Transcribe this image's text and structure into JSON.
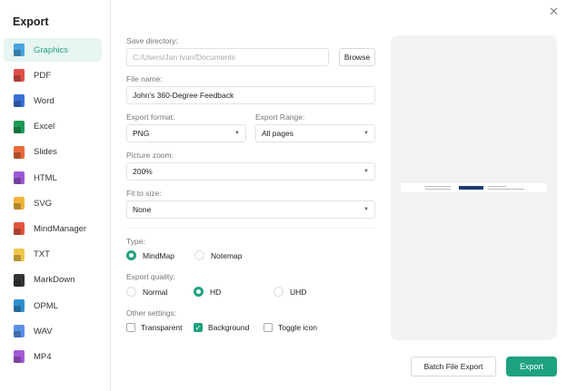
{
  "title": "Export",
  "sidebar": {
    "items": [
      {
        "label": "Graphics",
        "color": "#4aa3e0"
      },
      {
        "label": "PDF",
        "color": "#e0504a"
      },
      {
        "label": "Word",
        "color": "#3b6fd8"
      },
      {
        "label": "Excel",
        "color": "#1f9a55"
      },
      {
        "label": "Slides",
        "color": "#e86a3a"
      },
      {
        "label": "HTML",
        "color": "#9b59d6"
      },
      {
        "label": "SVG",
        "color": "#f0b43c"
      },
      {
        "label": "MindManager",
        "color": "#e2553f"
      },
      {
        "label": "TXT",
        "color": "#f0c64a"
      },
      {
        "label": "MarkDown",
        "color": "#333333"
      },
      {
        "label": "OPML",
        "color": "#2e8fd0"
      },
      {
        "label": "WAV",
        "color": "#5b8fe6"
      },
      {
        "label": "MP4",
        "color": "#a45ad6"
      }
    ]
  },
  "form": {
    "save_directory_label": "Save directory:",
    "save_directory_placeholder": "C:/Users/Jan Ivan/Documents",
    "browse": "Browse",
    "file_name_label": "File name:",
    "file_name": "John's 360-Degree Feedback",
    "export_format_label": "Export format:",
    "export_format": "PNG",
    "export_range_label": "Export Range:",
    "export_range": "All pages",
    "picture_zoom_label": "Picture zoom:",
    "picture_zoom": "200%",
    "fit_label": "Fit to size:",
    "fit": "None",
    "type_label": "Type:",
    "type_options": [
      "MindMap",
      "Notemap"
    ],
    "quality_label": "Export quality:",
    "quality_options": [
      "Normal",
      "HD",
      "UHD"
    ],
    "other_label": "Other settings:",
    "other_options": [
      "Transparent",
      "Background",
      "Toggle icon"
    ]
  },
  "buttons": {
    "batch": "Batch File Export",
    "export": "Export"
  },
  "accent": "#1ea27f"
}
